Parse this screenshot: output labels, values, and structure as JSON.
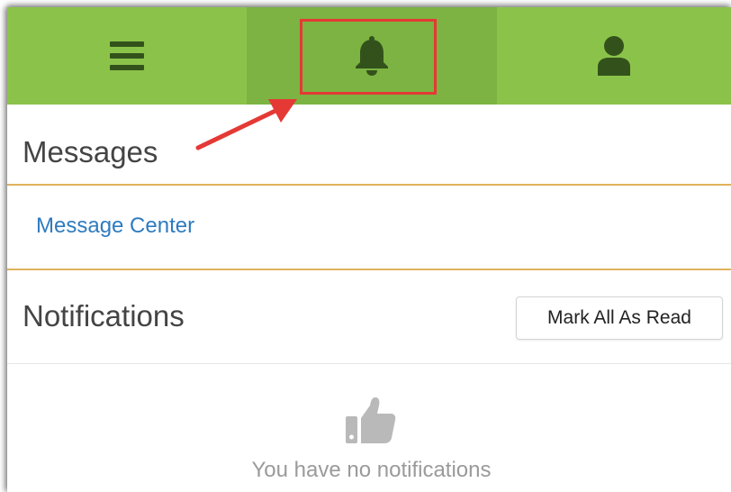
{
  "navbar": {
    "color": "#8bc34a",
    "active_color": "#7cb342",
    "icon_color": "#33521b",
    "items": [
      {
        "icon": "menu-icon"
      },
      {
        "icon": "bell-icon",
        "active": true,
        "highlighted": true
      },
      {
        "icon": "user-icon"
      }
    ]
  },
  "annotation": {
    "color": "#e53935",
    "target": "bell-icon"
  },
  "messages": {
    "title": "Messages",
    "divider_color": "#e0b15c",
    "message_center_label": "Message Center",
    "link_color": "#2f7bbf"
  },
  "notifications": {
    "title": "Notifications",
    "mark_all_label": "Mark All As Read",
    "empty_icon": "thumbs-up-icon",
    "empty_text": "You have no notifications"
  }
}
